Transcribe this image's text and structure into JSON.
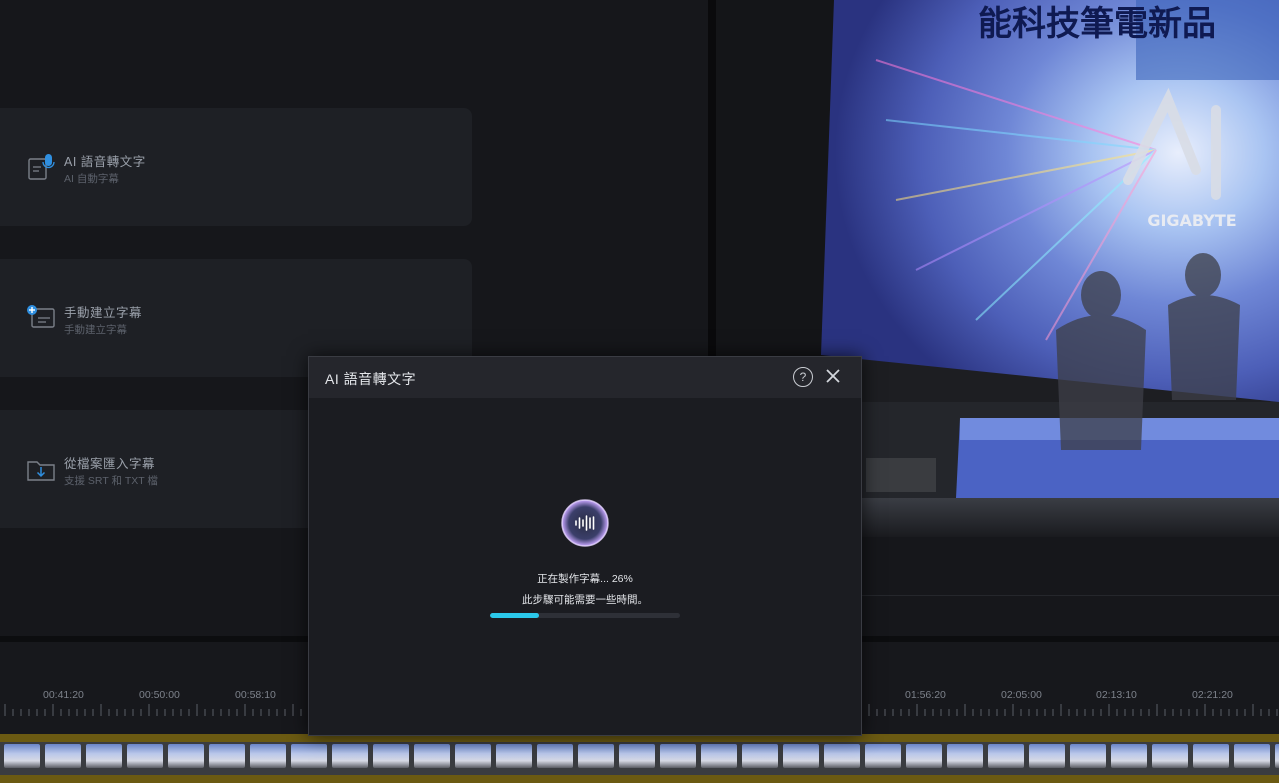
{
  "options": [
    {
      "title": "AI 語音轉文字",
      "subtitle": "AI 自動字幕"
    },
    {
      "title": "手動建立字幕",
      "subtitle": "手動建立字幕"
    },
    {
      "title": "從檔案匯入字幕",
      "subtitle": "支援 SRT 和 TXT 檔"
    }
  ],
  "preview": {
    "banner_text": "能科技筆電新品",
    "brand": "GIGABYTE"
  },
  "timeline": {
    "ticks": [
      "00:41:20",
      "00:50:00",
      "00:58:10",
      "01:56:20",
      "02:05:00",
      "02:13:10",
      "02:21:20"
    ]
  },
  "dialog": {
    "title": "AI 語音轉文字",
    "help_label": "?",
    "status": "正在製作字幕... 26%",
    "hint": "此步驟可能需要一些時間。",
    "progress": 0.26
  },
  "colors": {
    "accent": "#2bc8ea",
    "timeline_track": "#6b5a12"
  }
}
